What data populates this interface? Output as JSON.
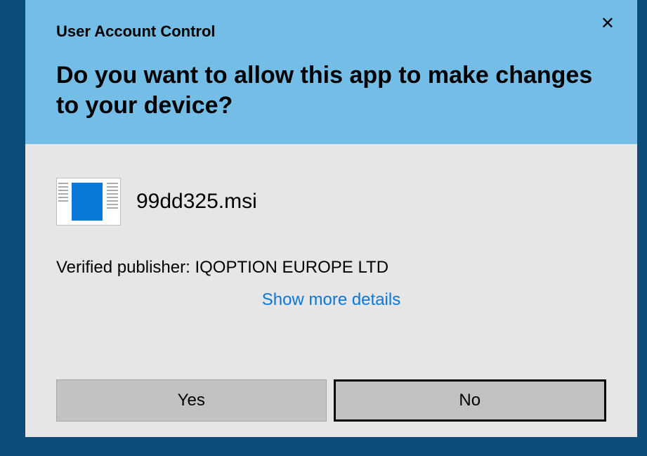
{
  "header": {
    "title_small": "User Account Control",
    "title_large": "Do you want to allow this app to make changes to your device?"
  },
  "app": {
    "filename": "99dd325.msi"
  },
  "publisher": {
    "label": "Verified publisher:",
    "name": "IQOPTION EUROPE LTD"
  },
  "details_link": "Show more details",
  "buttons": {
    "yes": "Yes",
    "no": "No"
  }
}
